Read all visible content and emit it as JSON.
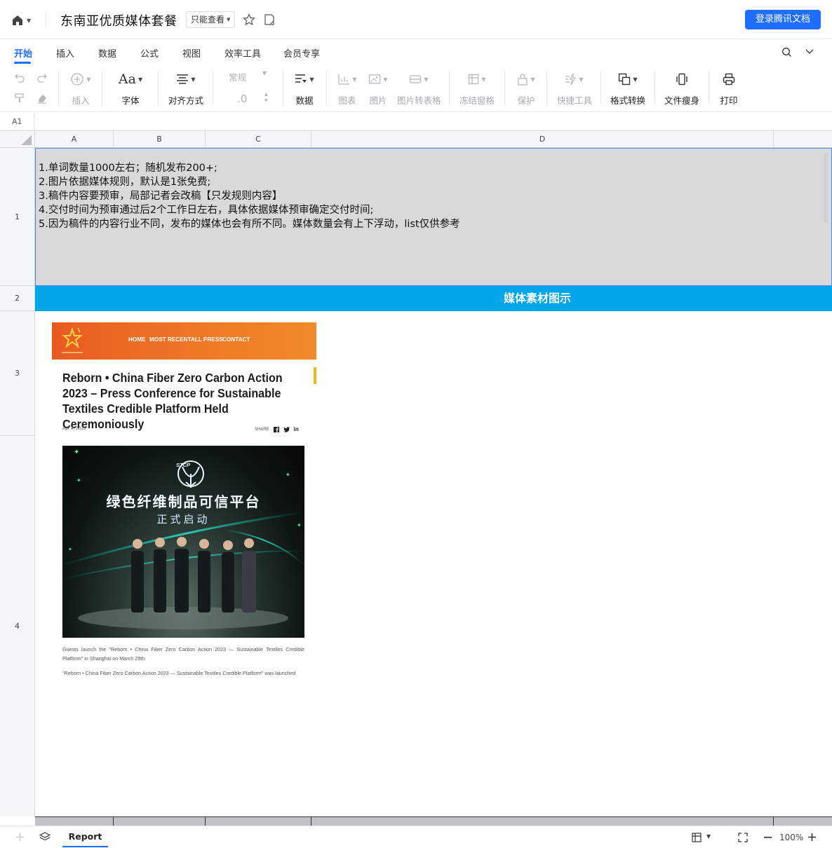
{
  "topbar": {
    "title": "东南亚优质媒体套餐",
    "readonly_label": "只能查看",
    "login_label": "登录腾讯文档"
  },
  "menu": {
    "tabs": [
      "开始",
      "插入",
      "数据",
      "公式",
      "视图",
      "效率工具",
      "会员专享"
    ],
    "active": "开始"
  },
  "toolbar": {
    "insert": "插入",
    "font": "字体",
    "align": "对齐方式",
    "number_format": "常规",
    "decimal": ".0",
    "data": "数据",
    "chart": "图表",
    "image": "图片",
    "image_to_table": "图片转表格",
    "freeze": "冻结窗格",
    "protect": "保护",
    "quick_tools": "快捷工具",
    "format_convert": "格式转换",
    "slim": "文件瘦身",
    "print": "打印"
  },
  "formula_bar": {
    "cell_ref": "A1"
  },
  "grid": {
    "columns": [
      "A",
      "B",
      "C",
      "D"
    ],
    "rows": [
      "1",
      "2",
      "3",
      "4"
    ],
    "notes": [
      "1.单词数量1000左右；随机发布200+;",
      "2.图片依据媒体规则，默认是1张免费;",
      "3.稿件内容要预审，局部记者会改稿【只发规则内容】",
      "4.交付时间为预审通过后2个工作日左右，具体依据媒体预审确定交付时间;",
      "5.因为稿件的内容行业不同，发布的媒体也会有所不同。媒体数量会有上下浮动，list仅供参考"
    ],
    "section_header": "媒体素材图示"
  },
  "article": {
    "nav": [
      "HOME",
      "MOST RECENT",
      "ALL PRESS",
      "CONTACT"
    ],
    "title": "Reborn • China Fiber Zero Carbon Action 2023 – Press Conference for Sustainable Textiles Credible Platform Held Ceremoniously",
    "date": "Apr 4, 2023",
    "share_label": "SHARE",
    "photo_badge": "STCP",
    "photo_headline": "绿色纤维制品可信平台",
    "photo_subline": "正式启动",
    "caption": "Guests launch the \"Reborn • China Fiber Zero Carbon Action 2023 — Sustainable Textiles Credible Platform\" in Shanghai on March 29th.",
    "body": "\"Reborn • China Fiber Zero Carbon Action 2023 — Sustainable Textiles Credible Platform\" was launched"
  },
  "bottom": {
    "sheet_tab": "Report",
    "zoom": "100%"
  },
  "colors": {
    "accent": "#1e6fff",
    "section_header_bg": "#00a6e8",
    "notes_bg": "#d9d9d9",
    "article_nav": "#e95a21"
  }
}
